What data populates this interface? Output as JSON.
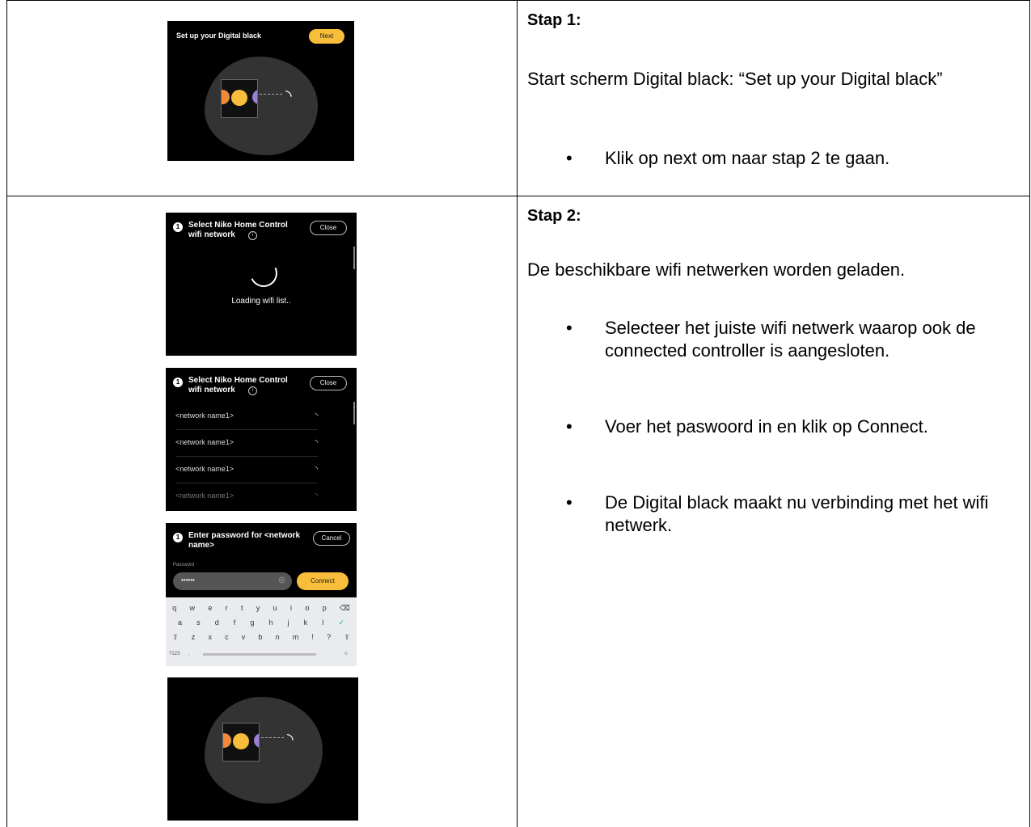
{
  "step1": {
    "heading": "Stap 1:",
    "description": "Start scherm Digital black: “Set up your Digital black”",
    "bullets": [
      "Klik op next om naar stap 2 te gaan."
    ],
    "screen": {
      "title": "Set up your Digital black",
      "next_label": "Next"
    }
  },
  "step2": {
    "heading": "Stap 2:",
    "description": "De beschikbare wifi netwerken worden geladen.",
    "bullets": [
      "Selecteer het juiste wifi netwerk waarop ook de connected controller is aangesloten.",
      "Voer het paswoord in en klik op Connect.",
      "De Digital black maakt nu verbinding met het wifi netwerk."
    ],
    "screen_loading": {
      "step_number": "1",
      "title": "Select Niko Home Control wifi network",
      "close_label": "Close",
      "loading_text": "Loading wifi list.."
    },
    "screen_list": {
      "step_number": "1",
      "title": "Select Niko Home Control wifi network",
      "close_label": "Close",
      "networks": [
        "<network name1>",
        "<network name1>",
        "<network name1>",
        "<network name1>"
      ]
    },
    "screen_password": {
      "step_number": "1",
      "title": "Enter password for <network name>",
      "cancel_label": "Cancel",
      "password_label": "Password",
      "password_value": "••••••",
      "connect_label": "Connect",
      "keyboard": {
        "row1": [
          "q",
          "w",
          "e",
          "r",
          "t",
          "y",
          "u",
          "i",
          "o",
          "p",
          "⌫"
        ],
        "row2": [
          "a",
          "s",
          "d",
          "f",
          "g",
          "h",
          "j",
          "k",
          "l",
          "✓"
        ],
        "row3": [
          "⇧",
          "z",
          "x",
          "c",
          "v",
          "b",
          "n",
          "m",
          "!",
          "?",
          "⇧"
        ],
        "row4": [
          "?123",
          ",",
          "",
          ".",
          "☺"
        ]
      }
    }
  },
  "colors": {
    "accent": "#f8bd3a",
    "screen_bg": "#000000",
    "blob": "#333333"
  }
}
